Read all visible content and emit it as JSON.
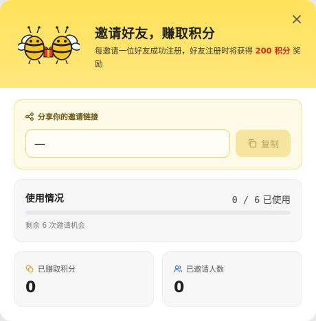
{
  "header": {
    "title": "邀请好友，赚取积分",
    "desc_before": "每邀请一位好友成功注册，好友注册时将获得 ",
    "desc_points": "200 积分",
    "desc_after": " 奖励",
    "icons": {
      "mascot": "bees-with-gift",
      "close": "close-icon"
    },
    "colors": {
      "banner": "#ffe25a",
      "points": "#d6281c"
    }
  },
  "share": {
    "label": "分享你的邀请链接",
    "link_value": "—",
    "copy_label": "复制",
    "icons": {
      "share": "share-icon",
      "copy": "copy-icon"
    }
  },
  "usage": {
    "title": "使用情况",
    "used_text": "0 / 6",
    "used_suffix": "已使用",
    "used_fraction": 0,
    "remaining_text": "剩余 6 次邀请机会"
  },
  "stats": {
    "points": {
      "label": "已赚取积分",
      "value": "0",
      "icon": "coins-icon"
    },
    "invited": {
      "label": "已邀请人数",
      "value": "0",
      "icon": "users-icon"
    }
  }
}
